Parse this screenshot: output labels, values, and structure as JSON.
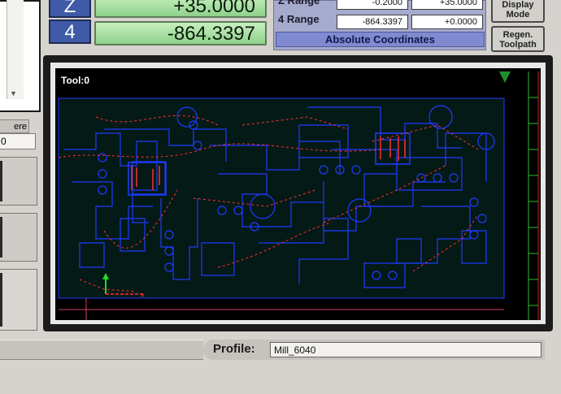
{
  "dro": {
    "axes": [
      {
        "axis": "Z",
        "value": "+35.0000"
      },
      {
        "axis": "4",
        "value": "-864.3397"
      }
    ]
  },
  "range": {
    "rows": [
      {
        "label": "Z Range",
        "min": "-0.2000",
        "max": "+35.0000"
      },
      {
        "label": "4 Range",
        "min": "-864.3397",
        "max": "+0.0000"
      }
    ],
    "absolute_label": "Absolute Coordinates"
  },
  "buttons": {
    "display_mode": "Display Mode",
    "regen_toolpath": "Regen. Toolpath"
  },
  "left": {
    "here_label": "ere",
    "field_value": "0"
  },
  "viewport": {
    "tool_label": "Tool:0",
    "colors": {
      "background": "#000000",
      "board": "#041a16",
      "traces": "#1f3bff",
      "rapid_moves": "#ff3030",
      "axis_y": "#22dd22",
      "ruler": "#2fbf2f"
    }
  },
  "profile": {
    "label": "Profile:",
    "value": "Mill_6040"
  }
}
